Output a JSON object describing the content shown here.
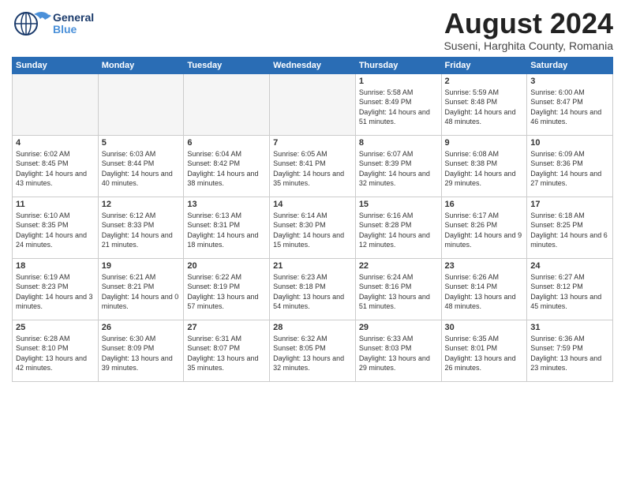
{
  "header": {
    "logo_general": "General",
    "logo_blue": "Blue",
    "month_title": "August 2024",
    "subtitle": "Suseni, Harghita County, Romania"
  },
  "days_of_week": [
    "Sunday",
    "Monday",
    "Tuesday",
    "Wednesday",
    "Thursday",
    "Friday",
    "Saturday"
  ],
  "weeks": [
    [
      {
        "day": "",
        "empty": true
      },
      {
        "day": "",
        "empty": true
      },
      {
        "day": "",
        "empty": true
      },
      {
        "day": "",
        "empty": true
      },
      {
        "day": "1",
        "sunrise": "5:58 AM",
        "sunset": "8:49 PM",
        "daylight": "14 hours and 51 minutes."
      },
      {
        "day": "2",
        "sunrise": "5:59 AM",
        "sunset": "8:48 PM",
        "daylight": "14 hours and 48 minutes."
      },
      {
        "day": "3",
        "sunrise": "6:00 AM",
        "sunset": "8:47 PM",
        "daylight": "14 hours and 46 minutes."
      }
    ],
    [
      {
        "day": "4",
        "sunrise": "6:02 AM",
        "sunset": "8:45 PM",
        "daylight": "14 hours and 43 minutes."
      },
      {
        "day": "5",
        "sunrise": "6:03 AM",
        "sunset": "8:44 PM",
        "daylight": "14 hours and 40 minutes."
      },
      {
        "day": "6",
        "sunrise": "6:04 AM",
        "sunset": "8:42 PM",
        "daylight": "14 hours and 38 minutes."
      },
      {
        "day": "7",
        "sunrise": "6:05 AM",
        "sunset": "8:41 PM",
        "daylight": "14 hours and 35 minutes."
      },
      {
        "day": "8",
        "sunrise": "6:07 AM",
        "sunset": "8:39 PM",
        "daylight": "14 hours and 32 minutes."
      },
      {
        "day": "9",
        "sunrise": "6:08 AM",
        "sunset": "8:38 PM",
        "daylight": "14 hours and 29 minutes."
      },
      {
        "day": "10",
        "sunrise": "6:09 AM",
        "sunset": "8:36 PM",
        "daylight": "14 hours and 27 minutes."
      }
    ],
    [
      {
        "day": "11",
        "sunrise": "6:10 AM",
        "sunset": "8:35 PM",
        "daylight": "14 hours and 24 minutes."
      },
      {
        "day": "12",
        "sunrise": "6:12 AM",
        "sunset": "8:33 PM",
        "daylight": "14 hours and 21 minutes."
      },
      {
        "day": "13",
        "sunrise": "6:13 AM",
        "sunset": "8:31 PM",
        "daylight": "14 hours and 18 minutes."
      },
      {
        "day": "14",
        "sunrise": "6:14 AM",
        "sunset": "8:30 PM",
        "daylight": "14 hours and 15 minutes."
      },
      {
        "day": "15",
        "sunrise": "6:16 AM",
        "sunset": "8:28 PM",
        "daylight": "14 hours and 12 minutes."
      },
      {
        "day": "16",
        "sunrise": "6:17 AM",
        "sunset": "8:26 PM",
        "daylight": "14 hours and 9 minutes."
      },
      {
        "day": "17",
        "sunrise": "6:18 AM",
        "sunset": "8:25 PM",
        "daylight": "14 hours and 6 minutes."
      }
    ],
    [
      {
        "day": "18",
        "sunrise": "6:19 AM",
        "sunset": "8:23 PM",
        "daylight": "14 hours and 3 minutes."
      },
      {
        "day": "19",
        "sunrise": "6:21 AM",
        "sunset": "8:21 PM",
        "daylight": "14 hours and 0 minutes."
      },
      {
        "day": "20",
        "sunrise": "6:22 AM",
        "sunset": "8:19 PM",
        "daylight": "13 hours and 57 minutes."
      },
      {
        "day": "21",
        "sunrise": "6:23 AM",
        "sunset": "8:18 PM",
        "daylight": "13 hours and 54 minutes."
      },
      {
        "day": "22",
        "sunrise": "6:24 AM",
        "sunset": "8:16 PM",
        "daylight": "13 hours and 51 minutes."
      },
      {
        "day": "23",
        "sunrise": "6:26 AM",
        "sunset": "8:14 PM",
        "daylight": "13 hours and 48 minutes."
      },
      {
        "day": "24",
        "sunrise": "6:27 AM",
        "sunset": "8:12 PM",
        "daylight": "13 hours and 45 minutes."
      }
    ],
    [
      {
        "day": "25",
        "sunrise": "6:28 AM",
        "sunset": "8:10 PM",
        "daylight": "13 hours and 42 minutes."
      },
      {
        "day": "26",
        "sunrise": "6:30 AM",
        "sunset": "8:09 PM",
        "daylight": "13 hours and 39 minutes."
      },
      {
        "day": "27",
        "sunrise": "6:31 AM",
        "sunset": "8:07 PM",
        "daylight": "13 hours and 35 minutes."
      },
      {
        "day": "28",
        "sunrise": "6:32 AM",
        "sunset": "8:05 PM",
        "daylight": "13 hours and 32 minutes."
      },
      {
        "day": "29",
        "sunrise": "6:33 AM",
        "sunset": "8:03 PM",
        "daylight": "13 hours and 29 minutes."
      },
      {
        "day": "30",
        "sunrise": "6:35 AM",
        "sunset": "8:01 PM",
        "daylight": "13 hours and 26 minutes."
      },
      {
        "day": "31",
        "sunrise": "6:36 AM",
        "sunset": "7:59 PM",
        "daylight": "13 hours and 23 minutes."
      }
    ]
  ]
}
